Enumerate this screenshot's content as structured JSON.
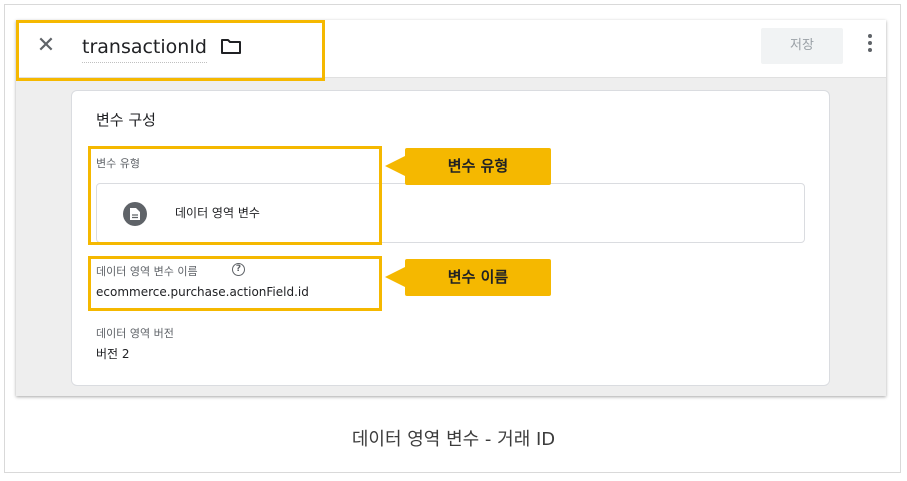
{
  "header": {
    "close_glyph": "✕",
    "variable_name": "transactionId",
    "save_label": "저장"
  },
  "card": {
    "title": "변수 구성",
    "type_label": "변수 유형",
    "type_value": "데이터 영역 변수",
    "name_label": "데이터 영역 변수 이름",
    "help_glyph": "?",
    "name_value": "ecommerce.purchase.actionField.id",
    "version_label": "데이터 영역 버전",
    "version_value": "버전 2"
  },
  "callouts": {
    "type": "변수 유형",
    "name": "변수 이름"
  },
  "caption": "데이터 영역 변수 - 거래 ID",
  "colors": {
    "highlight": "#f5b800",
    "icon": "#5f6368"
  },
  "icons": [
    "close-icon",
    "folder-icon",
    "more-vert-icon",
    "document-icon",
    "help-icon"
  ]
}
